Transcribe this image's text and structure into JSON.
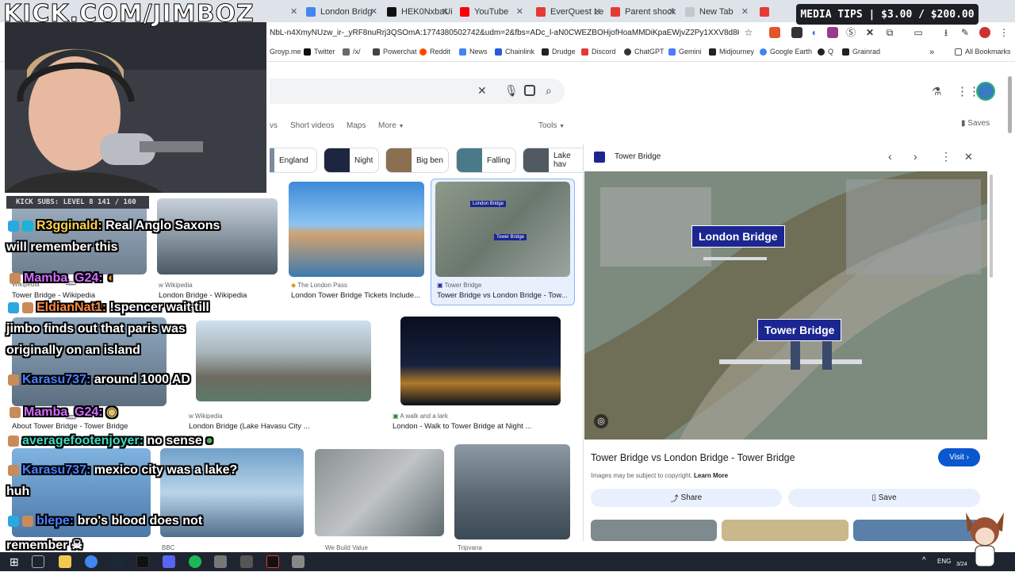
{
  "overlay": {
    "kick_title": "KICK.COM/JIMBOZ",
    "media_tips": "MEDIA TIPS | $3.00 / $200.00",
    "subs": "KICK SUBS: LEVEL 8 141 / 160"
  },
  "browser": {
    "tabs": [
      {
        "label": "London Bridg",
        "color": "#4285f4"
      },
      {
        "label": "HEK0NxbaUi",
        "color": "#111111"
      },
      {
        "label": "YouTube",
        "color": "#ff0000"
      },
      {
        "label": "EverQuest Le",
        "color": "#e53935"
      },
      {
        "label": "Parent shock",
        "color": "#e53935"
      },
      {
        "label": "New Tab",
        "color": "#9aa0a6"
      }
    ],
    "url": "NbL-n4XmyNUzw_ir-_yRF8nuRrj3QSOmA:1774380502742&udm=2&fbs=ADc_l-aN0CWEZBOHjofHoaMMDiKpaEWjvZ2Py1XXV8d8KvlI3jIjrY5C...",
    "bookmarks": [
      {
        "label": "Groyp.me",
        "color": "#8a8a8a"
      },
      {
        "label": "Twitter",
        "color": "#111111"
      },
      {
        "label": "/x/",
        "color": "#6a6a6a"
      },
      {
        "label": "Powerchat",
        "color": "#444444"
      },
      {
        "label": "Reddit",
        "color": "#ff4500"
      },
      {
        "label": "News",
        "color": "#4285f4"
      },
      {
        "label": "Chainlink",
        "color": "#2a5ada"
      },
      {
        "label": "Drudge",
        "color": "#222222"
      },
      {
        "label": "Discord",
        "color": "#e53935"
      },
      {
        "label": "ChatGPT",
        "color": "#333333"
      },
      {
        "label": "Gemini",
        "color": "#4f7cf7"
      },
      {
        "label": "Midjourney",
        "color": "#222222"
      },
      {
        "label": "Google Earth",
        "color": "#4285f4"
      },
      {
        "label": "Q",
        "color": "#222222"
      },
      {
        "label": "Grainrad",
        "color": "#222222"
      }
    ],
    "all_bookmarks": "All Bookmarks"
  },
  "search": {
    "nav_tabs": [
      "vs",
      "Short videos",
      "Maps",
      "More"
    ],
    "tools": "Tools",
    "saves": "Saves",
    "chips": [
      {
        "label": "England",
        "color": "#7a8aa0"
      },
      {
        "label": "Night",
        "color": "#1e2540"
      },
      {
        "label": "Big ben",
        "color": "#8a7050"
      },
      {
        "label": "Falling",
        "color": "#4a7a8a"
      },
      {
        "label": "Lake hav",
        "color": "#505a60"
      }
    ]
  },
  "results": [
    {
      "source": "Wikipedia",
      "title": "Tower Bridge - Wikipedia"
    },
    {
      "source": "Wikipedia",
      "title": "London Bridge - Wikipedia"
    },
    {
      "source": "The London Pass",
      "title": "London Tower Bridge Tickets Include..."
    },
    {
      "source": "Tower Bridge",
      "title": "Tower Bridge vs London Bridge - Tow..."
    },
    {
      "source": "Tower Bridge",
      "title": "About Tower Bridge - Tower Bridge"
    },
    {
      "source": "Wikipedia",
      "title": "London Bridge (Lake Havasu City ..."
    },
    {
      "source": "A walk and a lark",
      "title": "London - Walk to Tower Bridge at Night ..."
    },
    {
      "source": "BBC",
      "title": ""
    },
    {
      "source": "We Build Value",
      "title": ""
    },
    {
      "source": "Tripvana",
      "title": ""
    }
  ],
  "thumb_labels": {
    "london": "London Bridge",
    "tower": "Tower Bridge"
  },
  "panel": {
    "source": "Tower Bridge",
    "callout_london": "London Bridge",
    "callout_tower": "Tower Bridge",
    "title": "Tower Bridge vs London Bridge - Tower Bridge",
    "visit": "Visit",
    "copyright": "Images may be subject to copyright.",
    "learn_more": "Learn More",
    "share": "Share",
    "save": "Save"
  },
  "chat": [
    {
      "user": "R3gginald:",
      "msg": "Real Anglo Saxons"
    },
    {
      "user": "",
      "msg": "will remember this"
    },
    {
      "user": "Mamba_G24:",
      "msg": ""
    },
    {
      "user": "EldianNat1:",
      "msg": "!spencer wait till"
    },
    {
      "user": "",
      "msg": "jimbo finds out that paris was"
    },
    {
      "user": "",
      "msg": "originally on an island"
    },
    {
      "user": "Karasu737:",
      "msg": "around 1000 AD"
    },
    {
      "user": "Mamba_G24:",
      "msg": ""
    },
    {
      "user": "averagefootenjoyer:",
      "msg": "no sense"
    },
    {
      "user": "Karasu737:",
      "msg": "mexico city was a lake?"
    },
    {
      "user": "",
      "msg": "huh"
    },
    {
      "user": "blepe:",
      "msg": "bro's blood does not"
    },
    {
      "user": "",
      "msg": "remember"
    }
  ],
  "taskbar": {
    "lang": "ENG",
    "date": "3/24"
  }
}
